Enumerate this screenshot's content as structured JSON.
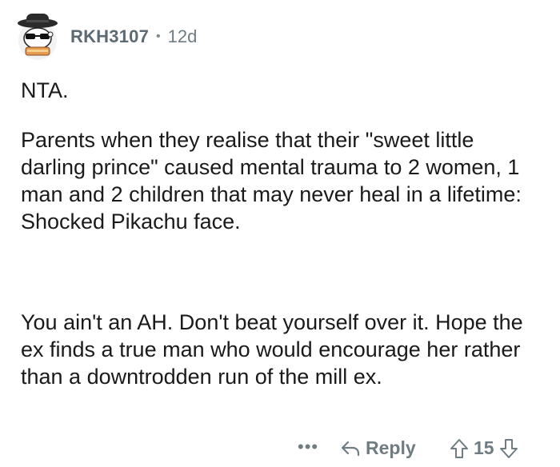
{
  "comment": {
    "author": "RKH3107",
    "separator": "•",
    "age": "12d",
    "paragraphs": [
      "NTA.",
      "Parents when they realise that their \"sweet little darling prince\" caused mental trauma to 2 women, 1 man and 2 children that may never heal in a lifetime: Shocked Pikachu face.",
      "You ain't an AH. Don't beat yourself over it. Hope the ex finds a true man who would encourage her rather than a downtrodden run of the mill ex."
    ],
    "actions": {
      "more_label": "•••",
      "reply_label": "Reply",
      "score": "15"
    }
  },
  "icons": {
    "avatar": "snoo-avatar-icon",
    "reply": "reply-arrow-icon",
    "upvote": "upvote-arrow-icon",
    "downvote": "downvote-arrow-icon"
  }
}
